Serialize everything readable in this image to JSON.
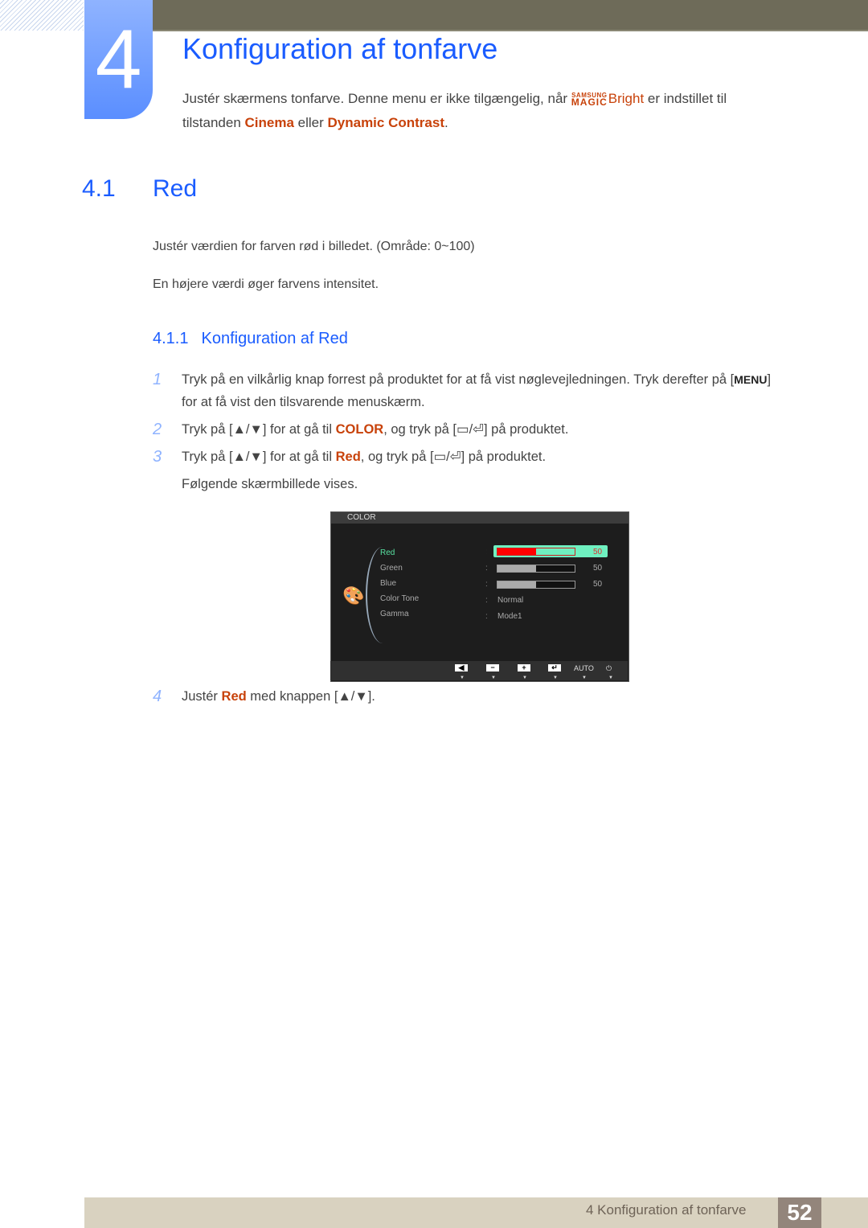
{
  "chapter": {
    "number": "4",
    "title": "Konfiguration af tonfarve",
    "intro_part1": "Justér skærmens tonfarve. Denne menu er ikke tilgængelig, når ",
    "magic_top": "SAMSUNG",
    "magic_bottom": "MAGIC",
    "magic_bright": "Bright",
    "intro_part2": " er indstillet til",
    "intro_line2_a": "tilstanden ",
    "intro_cinema": "Cinema",
    "intro_line2_b": " eller ",
    "intro_dynamic": "Dynamic Contrast",
    "intro_line2_c": "."
  },
  "section": {
    "number": "4.1",
    "title": "Red",
    "para1": "Justér værdien for farven rød i billedet. (Område: 0~100)",
    "para2": "En højere værdi øger farvens intensitet."
  },
  "subsection": {
    "number": "4.1.1",
    "title": "Konfiguration af Red"
  },
  "steps": [
    {
      "n": "1",
      "a": "Tryk på en vilkårlig knap forrest på produktet for at få vist nøglevejledningen. Tryk derefter på [",
      "key": "MENU",
      "b": "]",
      "line2": "for at få vist den tilsvarende menuskærm."
    },
    {
      "n": "2",
      "a": "Tryk på [▲/▼] for at gå til ",
      "hl": "COLOR",
      "b": ", og tryk på [▭/⏎] på produktet."
    },
    {
      "n": "3",
      "a": "Tryk på [▲/▼] for at gå til ",
      "hl": "Red",
      "b": ", og tryk på [▭/⏎] på produktet.",
      "line2": "Følgende skærmbillede vises."
    },
    {
      "n": "4",
      "a": "Justér ",
      "hl": "Red",
      "b": " med knappen [▲/▼]."
    }
  ],
  "osd": {
    "header": "COLOR",
    "items": [
      {
        "label": "Red",
        "value": "50",
        "level": 0.5,
        "selected": true
      },
      {
        "label": "Green",
        "value": "50",
        "level": 0.5
      },
      {
        "label": "Blue",
        "value": "50",
        "level": 0.5
      },
      {
        "label": "Color Tone",
        "text": "Normal"
      },
      {
        "label": "Gamma",
        "text": "Mode1"
      }
    ],
    "buttons": [
      "◀",
      "−",
      "+",
      "↵"
    ],
    "auto_label": "AUTO",
    "power_icon": "⏻"
  },
  "footer": {
    "text": "4 Konfiguration af tonfarve",
    "page": "52"
  }
}
